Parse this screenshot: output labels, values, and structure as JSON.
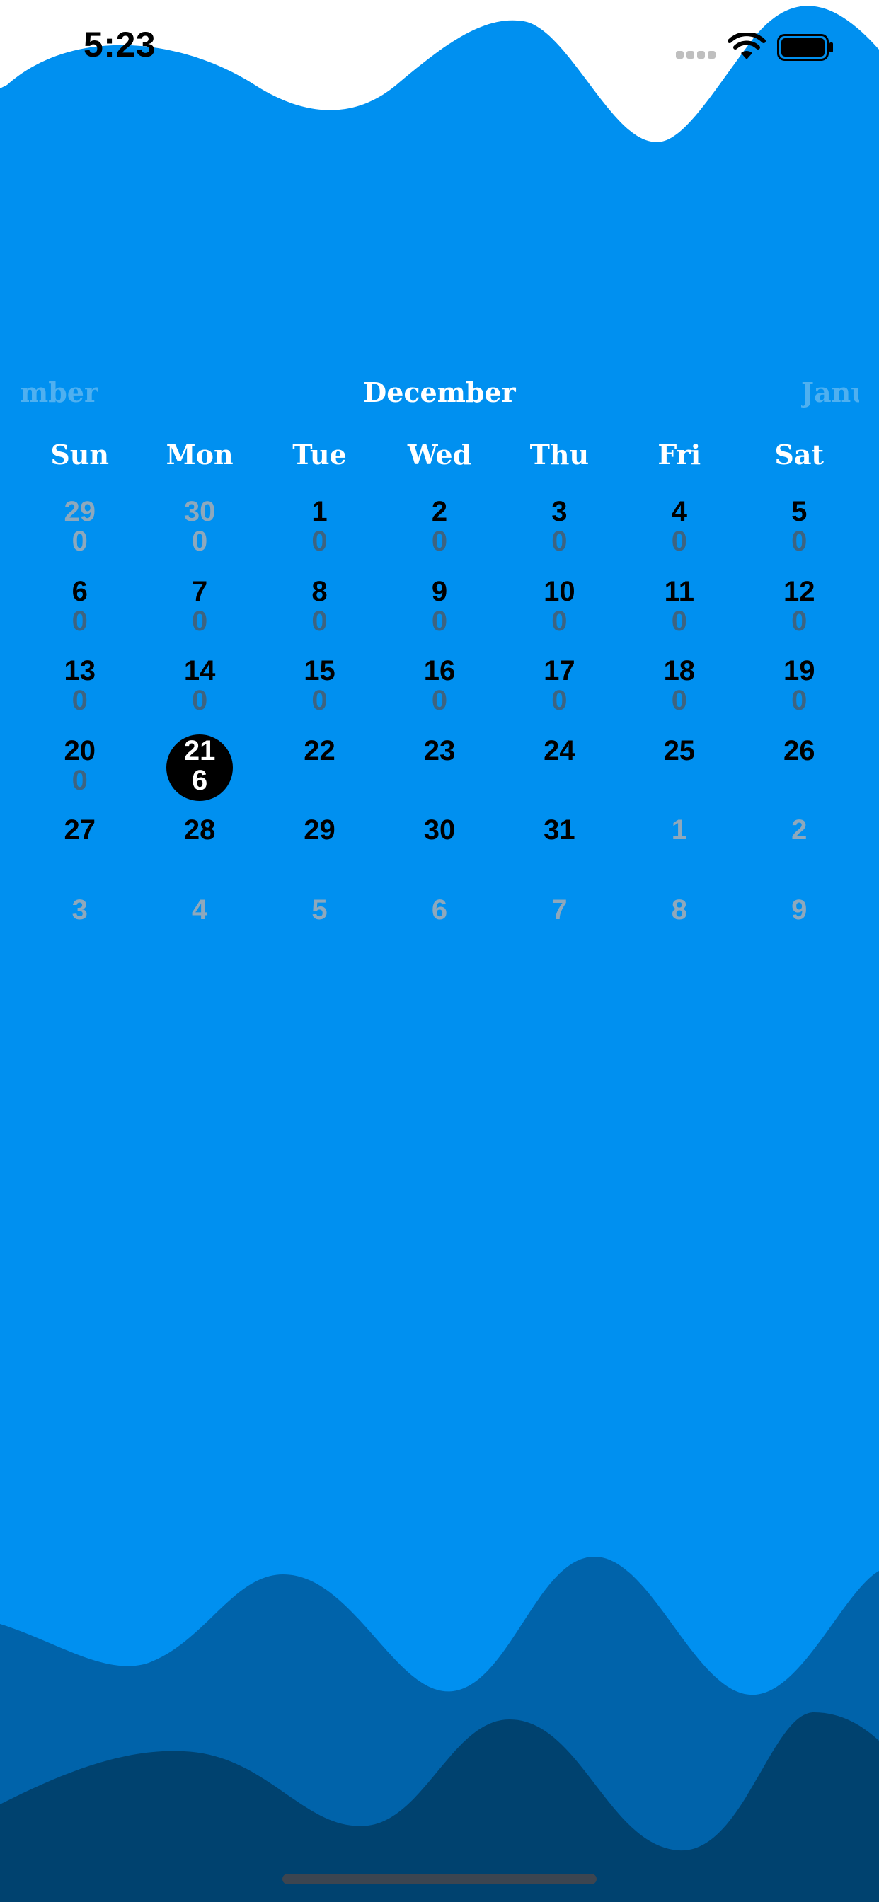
{
  "status_bar": {
    "time": "5:23"
  },
  "calendar": {
    "prev_month_fragment": "mber",
    "current_month": "December",
    "next_month_fragment": "Janu",
    "weekdays": [
      "Sun",
      "Mon",
      "Tue",
      "Wed",
      "Thu",
      "Fri",
      "Sat"
    ],
    "weeks": [
      [
        {
          "day": "29",
          "count": "0",
          "muted": true
        },
        {
          "day": "30",
          "count": "0",
          "muted": true
        },
        {
          "day": "1",
          "count": "0"
        },
        {
          "day": "2",
          "count": "0"
        },
        {
          "day": "3",
          "count": "0"
        },
        {
          "day": "4",
          "count": "0"
        },
        {
          "day": "5",
          "count": "0"
        }
      ],
      [
        {
          "day": "6",
          "count": "0"
        },
        {
          "day": "7",
          "count": "0"
        },
        {
          "day": "8",
          "count": "0"
        },
        {
          "day": "9",
          "count": "0"
        },
        {
          "day": "10",
          "count": "0"
        },
        {
          "day": "11",
          "count": "0"
        },
        {
          "day": "12",
          "count": "0"
        }
      ],
      [
        {
          "day": "13",
          "count": "0"
        },
        {
          "day": "14",
          "count": "0"
        },
        {
          "day": "15",
          "count": "0"
        },
        {
          "day": "16",
          "count": "0"
        },
        {
          "day": "17",
          "count": "0"
        },
        {
          "day": "18",
          "count": "0"
        },
        {
          "day": "19",
          "count": "0"
        }
      ],
      [
        {
          "day": "20",
          "count": "0"
        },
        {
          "day": "21",
          "count": "6",
          "selected": true
        },
        {
          "day": "22"
        },
        {
          "day": "23"
        },
        {
          "day": "24"
        },
        {
          "day": "25"
        },
        {
          "day": "26"
        }
      ],
      [
        {
          "day": "27"
        },
        {
          "day": "28"
        },
        {
          "day": "29"
        },
        {
          "day": "30"
        },
        {
          "day": "31"
        },
        {
          "day": "1",
          "muted": true
        },
        {
          "day": "2",
          "muted": true
        }
      ],
      [
        {
          "day": "3",
          "muted": true
        },
        {
          "day": "4",
          "muted": true
        },
        {
          "day": "5",
          "muted": true
        },
        {
          "day": "6",
          "muted": true
        },
        {
          "day": "7",
          "muted": true
        },
        {
          "day": "8",
          "muted": true
        },
        {
          "day": "9",
          "muted": true
        }
      ]
    ]
  },
  "colors": {
    "background": "#0090F0",
    "top_wave": "#FFFFFF",
    "bottom_wave_mid": "#0063AA",
    "bottom_wave_dark": "#00426F",
    "selected_day": "#000000"
  }
}
